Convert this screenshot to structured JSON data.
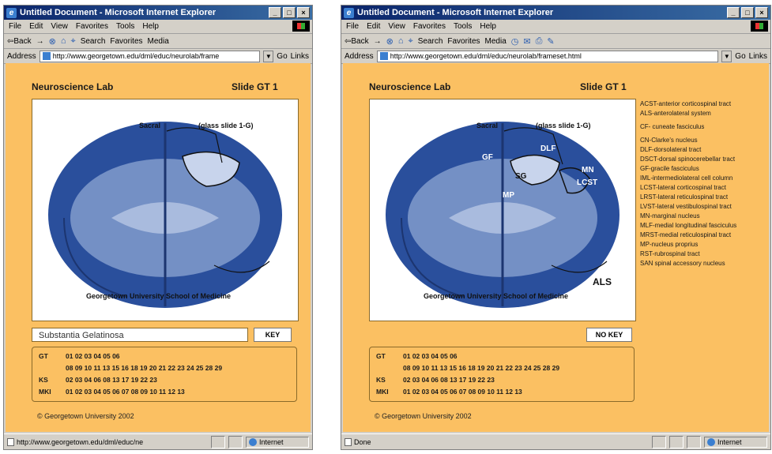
{
  "left_window": {
    "title": "Untitled Document - Microsoft Internet Explorer",
    "menu": [
      "File",
      "Edit",
      "View",
      "Favorites",
      "Tools",
      "Help"
    ],
    "toolbar": [
      "⇦Back",
      "→",
      "⊗",
      "⌂",
      "⌖",
      "Search",
      "Favorites",
      "Media"
    ],
    "address_label": "Address",
    "address_value": "http://www.georgetown.edu/dml/educ/neurolab/frame",
    "go_label": "Go",
    "links_label": "Links",
    "lab_title": "Neuroscience Lab",
    "slide_title": "Slide GT 1",
    "slide_caption_top": "Sacral",
    "slide_caption_glass": "(glass slide 1-G)",
    "slide_caption_bottom": "Georgetown University School of Medicine",
    "answer": "Substantia Gelatinosa",
    "key_button": "KEY",
    "index": {
      "gt_label": "GT",
      "gt_line1": "01 02 03 04 05 06",
      "gt_line2": "08 09 10 11 13 15 16 18 19 20 21 22 23 24 25 28 29",
      "ks_label": "KS",
      "ks_line": "02 03 04 06 08 13 17 19 22 23",
      "mki_label": "MKI",
      "mki_line": "01 02 03 04 05 06 07 08 09 10 11 12 13"
    },
    "copyright": "© Georgetown University 2002",
    "status": "http://www.georgetown.edu/dml/educ/ne",
    "zone": "Internet"
  },
  "right_window": {
    "title": "Untitled Document - Microsoft Internet Explorer",
    "menu": [
      "File",
      "Edit",
      "View",
      "Favorites",
      "Tools",
      "Help"
    ],
    "toolbar": [
      "⇦Back",
      "→",
      "⊗",
      "⌂",
      "⌖",
      "Search",
      "Favorites",
      "Media"
    ],
    "address_label": "Address",
    "address_value": "http://www.georgetown.edu/dml/educ/neurolab/frameset.html",
    "go_label": "Go",
    "links_label": "Links",
    "lab_title": "Neuroscience Lab",
    "slide_title": "Slide GT 1",
    "slide_caption_top": "Sacral",
    "slide_caption_glass": "(glass slide 1-G)",
    "slide_caption_bottom": "Georgetown University School of Medicine",
    "labels": {
      "gf": "GF",
      "dlf": "DLF",
      "mn": "MN",
      "sg": "SG",
      "lcst": "LCST",
      "mp": "MP",
      "als": "ALS"
    },
    "key_button": "NO KEY",
    "index": {
      "gt_label": "GT",
      "gt_line1": "01 02 03 04 05 06",
      "gt_line2": "08 09 10 11 13 15 16 18 19 20 21 22 23 24 25 28 29",
      "ks_label": "KS",
      "ks_line": "02 03 04 06 08 13 17 19 22 23",
      "mki_label": "MKI",
      "mki_line": "01 02 03 04 05 06 07 08 09 10 11 12 13"
    },
    "copyright": "© Georgetown University 2002",
    "key_list": [
      "ACST-anterior corticospinal tract",
      "ALS-anterolateral system",
      "CF- cuneate fasciculus",
      "CN-Clarke's nucleus",
      "DLF-dorsolateral tract",
      "DSCT-dorsal spinocerebellar tract",
      "GF-gracile fasciculus",
      "IML-intermediolateral cell column",
      "LCST-lateral corticospinal tract",
      "LRST-lateral reticulospinal tract",
      "LVST-lateral vestibulospinal tract",
      "MN-marginal nucleus",
      "MLF-medial longitudinal fasciculus",
      "MRST-medial reticulospinal tract",
      "MP-nucleus proprius",
      "RST-rubrospinal tract",
      "SAN spinal accessory nucleus"
    ],
    "status": "Done",
    "zone": "Internet"
  },
  "colors": {
    "page_bg": "#fbc062",
    "tissue": "#2a4f9c",
    "chrome": "#d4d0c8"
  }
}
